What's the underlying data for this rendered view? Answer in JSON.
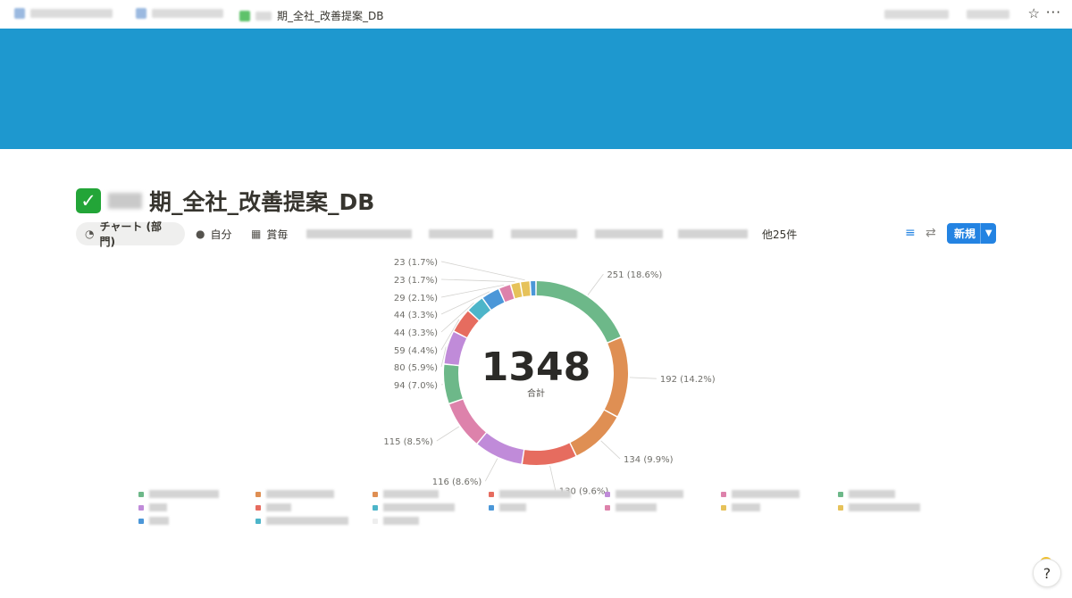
{
  "topbar": {
    "page_title": "期_全社_改善提案_DB"
  },
  "page": {
    "title": "期_全社_改善提案_DB"
  },
  "views": {
    "active_label": "チャート (部門)",
    "tab2_label": "自分",
    "tab3_label": "賞毎",
    "more_label": "他25件",
    "new_label": "新規"
  },
  "colors": {
    "cover": "#1e98cf",
    "accent": "#2383e2"
  },
  "chart_data": {
    "type": "pie",
    "style": "donut",
    "center_total": "1348",
    "center_label": "合計",
    "slices": [
      {
        "value": 251,
        "label": "251 (18.6%)",
        "color": "#6db889"
      },
      {
        "value": 192,
        "label": "192 (14.2%)",
        "color": "#df8f53"
      },
      {
        "value": 134,
        "label": "134 (9.9%)",
        "color": "#df8f53"
      },
      {
        "value": 130,
        "label": "130 (9.6%)",
        "color": "#e66c5f"
      },
      {
        "value": 116,
        "label": "116 (8.6%)",
        "color": "#c08bd9"
      },
      {
        "value": 115,
        "label": "115 (8.5%)",
        "color": "#dd82ab"
      },
      {
        "value": 94,
        "label": "94 (7.0%)",
        "color": "#6db889"
      },
      {
        "value": 80,
        "label": "80 (5.9%)",
        "color": "#c08bd9"
      },
      {
        "value": 59,
        "label": "59 (4.4%)",
        "color": "#e66c5f"
      },
      {
        "value": 44,
        "label": "44 (3.3%)",
        "color": "#4db5c9"
      },
      {
        "value": 44,
        "label": "44 (3.3%)",
        "color": "#4b97d8"
      },
      {
        "value": 29,
        "label": "29 (2.1%)",
        "color": "#dd82ab"
      },
      {
        "value": 23,
        "label": "23 (1.7%)",
        "color": "#e6c25a"
      },
      {
        "value": 23,
        "label": "23 (1.7%)",
        "color": "#e6c25a"
      },
      {
        "value": 14,
        "label": "",
        "color": "#4b97d8"
      }
    ]
  },
  "legend_colors": [
    "#6db889",
    "#c08bd9",
    "#4b97d8",
    "#df8f53",
    "#e66c5f",
    "#4db5c9",
    "#df8f53",
    "#4db5c9",
    "#eeeeee",
    "#e66c5f",
    "#4b97d8",
    "#c08bd9",
    "#dd82ab",
    "#dd82ab",
    "#e6c25a",
    "#6db889",
    "#e6c25a"
  ]
}
